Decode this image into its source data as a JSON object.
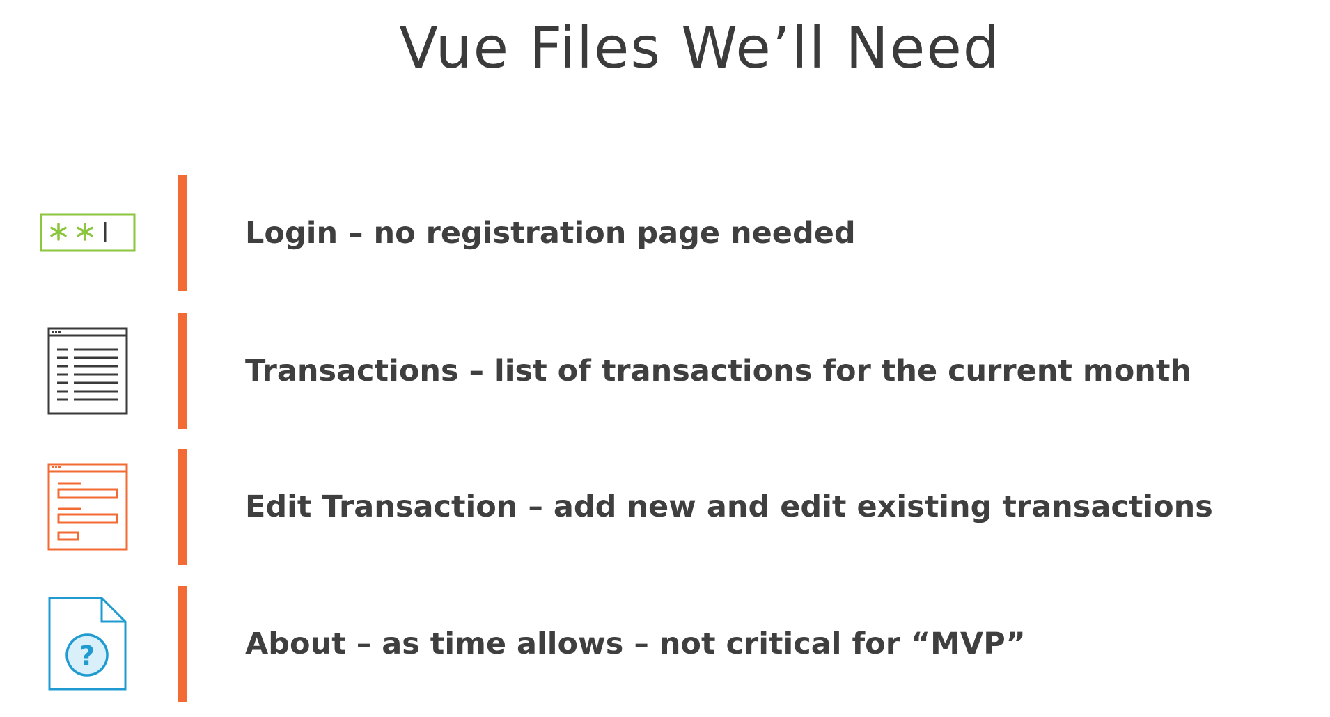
{
  "slide": {
    "title": "Vue Files We’ll Need",
    "items": [
      {
        "label": "Login – no registration page needed",
        "icon": "password-field-icon",
        "icon_color": "#8cc63f"
      },
      {
        "label": "Transactions – list of transactions for the current month",
        "icon": "list-page-icon",
        "icon_color": "#3a3a3a"
      },
      {
        "label": "Edit Transaction – add new and edit existing transactions",
        "icon": "form-page-icon",
        "icon_color": "#f26b35"
      },
      {
        "label": "About – as time allows – not critical for “MVP”",
        "icon": "help-document-icon",
        "icon_color": "#1f9bd1"
      }
    ],
    "accent_color": "#f26b35",
    "text_color": "#3f3f3f"
  }
}
